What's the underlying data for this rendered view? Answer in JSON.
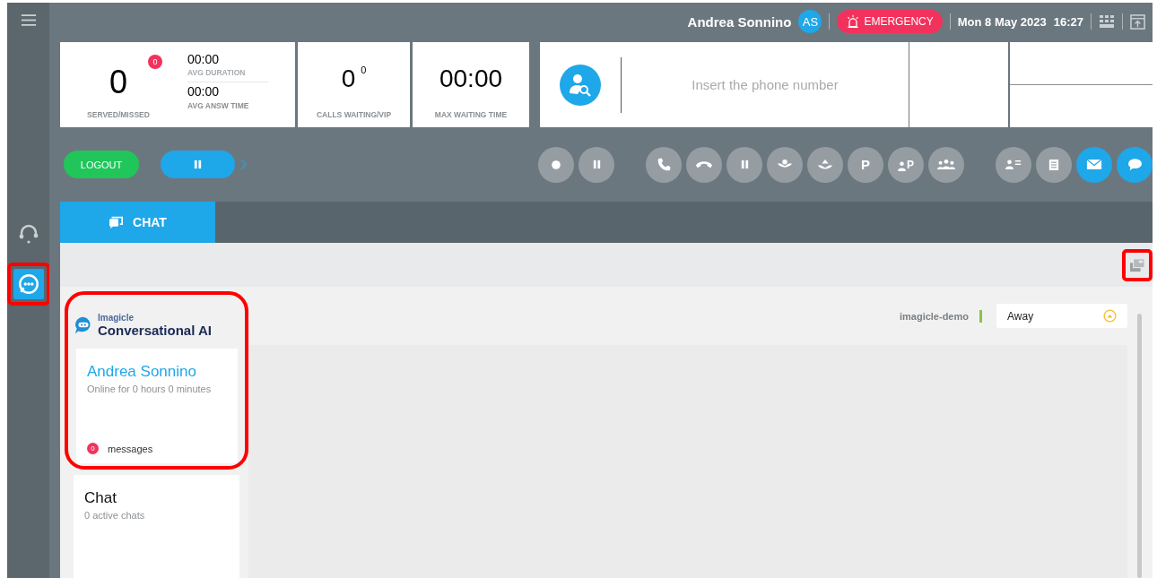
{
  "topbar": {
    "user_name": "Andrea Sonnino",
    "avatar_initials": "AS",
    "emergency_label": "EMERGENCY",
    "date": "Mon 8 May 2023",
    "time": "16:27"
  },
  "stats": {
    "served": "0",
    "missed_badge": "0",
    "served_label": "SERVED/MISSED",
    "avg_duration": "00:00",
    "avg_duration_label": "AVG DURATION",
    "avg_answer_time": "00:00",
    "avg_answer_label": "AVG ANSW TIME",
    "calls_waiting": "0",
    "vip": "0",
    "calls_waiting_label": "CALLS WAITING/VIP",
    "max_waiting": "00:00",
    "max_waiting_label": "MAX WAITING TIME"
  },
  "phone_search": {
    "placeholder": "Insert the phone number"
  },
  "agent_controls": {
    "logout": "LOGOUT"
  },
  "call_button_groups": [
    {
      "buttons": [
        {
          "kind": "record",
          "active": false
        },
        {
          "kind": "pause",
          "active": false
        }
      ]
    },
    {
      "buttons": [
        {
          "kind": "phone",
          "active": false
        },
        {
          "kind": "hangup",
          "active": false
        },
        {
          "kind": "pause",
          "active": false
        },
        {
          "kind": "hold",
          "active": false
        },
        {
          "kind": "unhold",
          "active": false
        },
        {
          "kind": "park",
          "label": "P",
          "active": false
        },
        {
          "kind": "user-park",
          "label": "P",
          "active": false
        },
        {
          "kind": "conference",
          "active": false
        }
      ]
    },
    {
      "buttons": [
        {
          "kind": "contact-list",
          "active": false
        },
        {
          "kind": "notes",
          "active": false
        },
        {
          "kind": "email",
          "active": true
        },
        {
          "kind": "chat",
          "active": true
        }
      ]
    }
  ],
  "rail": [
    {
      "kind": "headset",
      "selected": false,
      "highlighted": false
    },
    {
      "kind": "chat",
      "selected": true,
      "highlighted": true
    }
  ],
  "tabs": [
    {
      "label": "CHAT",
      "selected": true
    }
  ],
  "subbar": {
    "highlighted": true
  },
  "brand": {
    "small": "Imagicle",
    "large": "Conversational AI",
    "highlighted": true
  },
  "agent_card": {
    "name": "Andrea Sonnino",
    "online": "Online for  0 hours 0 minutes",
    "message_count": "0",
    "messages_label": "messages"
  },
  "chat_card": {
    "title": "Chat",
    "subtitle": "0 active chats"
  },
  "presence": {
    "account": "imagicle-demo",
    "status": "Away"
  }
}
